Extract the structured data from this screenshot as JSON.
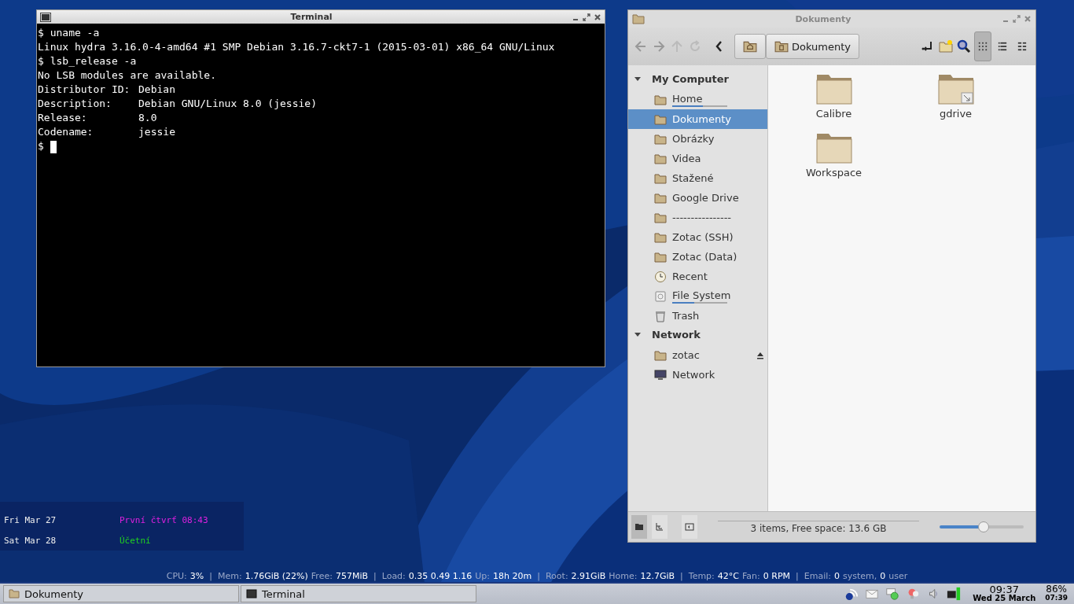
{
  "terminal": {
    "title": "Terminal",
    "lines": [
      "$ uname -a",
      "Linux hydra 3.16.0-4-amd64 #1 SMP Debian 3.16.7-ckt7-1 (2015-03-01) x86_64 GNU/Linux",
      "$ lsb_release -a",
      "No LSB modules are available.",
      "Distributor ID:\tDebian",
      "Description:\tDebian GNU/Linux 8.0 (jessie)",
      "Release:\t8.0",
      "Codename:\tjessie"
    ],
    "prompt": "$"
  },
  "file_manager": {
    "title": "Dokumenty",
    "breadcrumb": [
      {
        "kind": "home"
      },
      {
        "label": "Dokumenty",
        "kind": "doc"
      }
    ],
    "view_modes": [
      {
        "kind": "icons",
        "selected": true
      },
      {
        "kind": "list",
        "selected": false
      },
      {
        "kind": "compact",
        "selected": false
      }
    ],
    "sidebar": [
      {
        "heading": "My Computer",
        "expanded": true,
        "items": [
          {
            "label": "Home",
            "kind": "folder",
            "selected": false,
            "level": 0.55
          },
          {
            "label": "Dokumenty",
            "kind": "folder",
            "selected": true
          },
          {
            "label": "Obrázky",
            "kind": "folder",
            "selected": false
          },
          {
            "label": "Videa",
            "kind": "folder",
            "selected": false
          },
          {
            "label": "Stažené",
            "kind": "folder",
            "selected": false
          },
          {
            "label": "Google Drive",
            "kind": "folder",
            "selected": false
          },
          {
            "label": "----------------",
            "kind": "folder",
            "selected": false
          },
          {
            "label": "Zotac (SSH)",
            "kind": "folder",
            "selected": false
          },
          {
            "label": "Zotac (Data)",
            "kind": "folder",
            "selected": false
          },
          {
            "label": "Recent",
            "kind": "clock",
            "selected": false
          },
          {
            "label": "File System",
            "kind": "drive",
            "selected": false,
            "level": 0.4
          },
          {
            "label": "Trash",
            "kind": "trash",
            "selected": false
          }
        ]
      },
      {
        "heading": "Network",
        "expanded": true,
        "items": [
          {
            "label": "zotac",
            "kind": "folder",
            "selected": false,
            "eject": true
          },
          {
            "label": "Network",
            "kind": "computer",
            "selected": false
          }
        ]
      }
    ],
    "files": [
      {
        "name": "Calibre",
        "link": false
      },
      {
        "name": "gdrive",
        "link": true
      },
      {
        "name": "Workspace",
        "link": false
      }
    ],
    "status": "3 items, Free space: 13.6 GB",
    "bottom_tools": [
      {
        "kind": "places",
        "selected": true
      },
      {
        "kind": "tree",
        "selected": false
      },
      {
        "kind": "panel",
        "selected": false
      }
    ],
    "zoom": {
      "level": 0.49
    }
  },
  "conky": [
    {
      "date": "Fri Mar 27",
      "event": "První čtvrť 08:43",
      "color": "#e020e0"
    },
    {
      "date": "Sat Mar 28",
      "event": "Účetní",
      "color": "#20d020"
    }
  ],
  "system_monitor": {
    "separator": "|",
    "groups": [
      [
        {
          "text": "CPU:",
          "kind": "label"
        },
        {
          "text": "3%",
          "kind": "value"
        }
      ],
      [
        {
          "text": "Mem:",
          "kind": "label"
        },
        {
          "text": "1.76GiB (22%)",
          "kind": "value"
        },
        {
          "text": "Free:",
          "kind": "label"
        },
        {
          "text": "757MiB",
          "kind": "value"
        }
      ],
      [
        {
          "text": "Load:",
          "kind": "label"
        },
        {
          "text": "0.35 0.49 1.16",
          "kind": "value"
        },
        {
          "text": "Up:",
          "kind": "label"
        },
        {
          "text": "18h 20m",
          "kind": "value"
        }
      ],
      [
        {
          "text": "Root:",
          "kind": "label"
        },
        {
          "text": "2.91GiB",
          "kind": "value"
        },
        {
          "text": "Home:",
          "kind": "label"
        },
        {
          "text": "12.7GiB",
          "kind": "value"
        }
      ],
      [
        {
          "text": "Temp:",
          "kind": "label"
        },
        {
          "text": "42°C",
          "kind": "value"
        },
        {
          "text": "Fan:",
          "kind": "label"
        },
        {
          "text": "0 RPM",
          "kind": "value"
        }
      ],
      [
        {
          "text": "Email:",
          "kind": "label"
        },
        {
          "text": "0",
          "kind": "value"
        },
        {
          "text": "system,",
          "kind": "label"
        },
        {
          "text": "0",
          "kind": "value"
        },
        {
          "text": "user",
          "kind": "label"
        }
      ]
    ]
  },
  "taskbar": {
    "tasks": [
      {
        "label": "Dokumenty",
        "kind": "folder",
        "selected": false
      },
      {
        "label": "Terminal",
        "kind": "terminal",
        "selected": false
      }
    ],
    "tray": [
      {
        "kind": "network"
      },
      {
        "kind": "mail"
      },
      {
        "kind": "chat"
      },
      {
        "kind": "bulb"
      },
      {
        "kind": "volume"
      },
      {
        "kind": "power"
      }
    ],
    "clock": {
      "time": "09:37",
      "date": "Wed 25 March"
    },
    "battery": {
      "percent": "86%",
      "time": "07:39"
    }
  }
}
